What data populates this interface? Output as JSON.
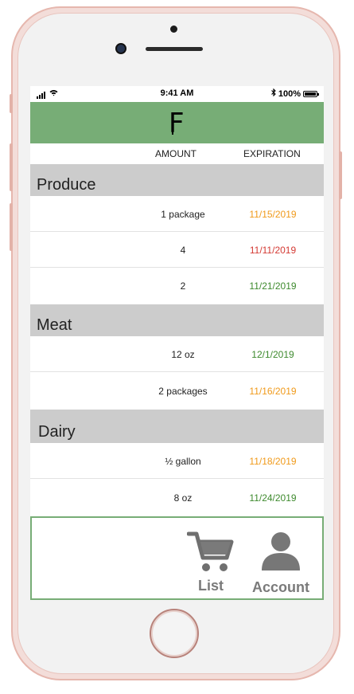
{
  "status_bar": {
    "time": "9:41 AM",
    "battery": "100%"
  },
  "header": {
    "logo_text": "F",
    "brand_color": "#77ad76"
  },
  "columns": {
    "amount": "AMOUNT",
    "expiration": "EXPIRATION"
  },
  "sections": [
    {
      "title": "Produce",
      "items": [
        {
          "amount": "1 package",
          "expiration": "11/15/2019",
          "status_color": "#f09a1b"
        },
        {
          "amount": "4",
          "expiration": "11/11/2019",
          "status_color": "#d43a34"
        },
        {
          "amount": "2",
          "expiration": "11/21/2019",
          "status_color": "#3e8a2e"
        }
      ]
    },
    {
      "title": "Meat",
      "items": [
        {
          "amount": "12 oz",
          "expiration": "12/1/2019",
          "status_color": "#3e8a2e"
        },
        {
          "amount": "2 packages",
          "expiration": "11/16/2019",
          "status_color": "#f09a1b"
        }
      ]
    },
    {
      "title": "Dairy",
      "items": [
        {
          "amount": "½ gallon",
          "expiration": "11/18/2019",
          "status_color": "#f09a1b"
        },
        {
          "amount": "8 oz",
          "expiration": "11/24/2019",
          "status_color": "#3e8a2e"
        }
      ]
    }
  ],
  "bottom_nav": {
    "list_label": "List",
    "list_icon": "cart-icon",
    "account_label": "Account",
    "account_icon": "user-icon"
  }
}
